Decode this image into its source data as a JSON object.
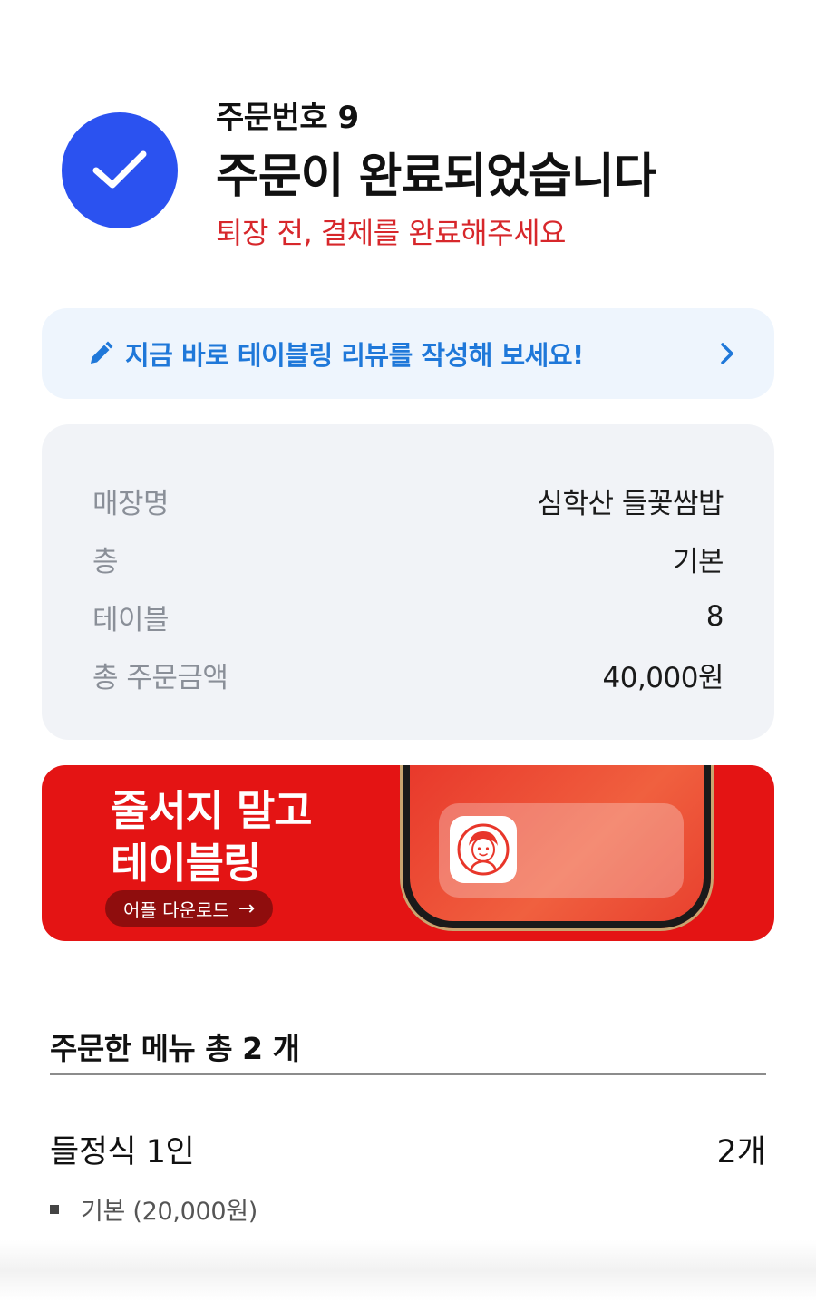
{
  "header": {
    "order_number": "주문번호 9",
    "title": "주문이 완료되었습니다",
    "notice": "퇴장 전, 결제를 완료해주세요"
  },
  "review_banner": {
    "text": "지금 바로 테이블링 리뷰를 작성해 보세요!",
    "icon": "pencil-icon",
    "arrow_icon": "chevron-right-icon"
  },
  "order_info": {
    "rows": [
      {
        "label": "매장명",
        "value": "심학산 들꽃쌈밥"
      },
      {
        "label": "층",
        "value": "기본"
      },
      {
        "label": "테이블",
        "value": "8"
      },
      {
        "label": "총 주문금액",
        "value": "40,000원"
      }
    ]
  },
  "promo": {
    "line1": "줄서지 말고",
    "line2": "테이블링",
    "button": "어플 다운로드",
    "button_arrow": "→"
  },
  "menu": {
    "title": "주문한 메뉴 총 2 개",
    "items": [
      {
        "name": "들정식 1인",
        "quantity": "2개",
        "option": "기본 (20,000원)"
      }
    ]
  },
  "colors": {
    "accent_blue": "#2b52f0",
    "notice_red": "#d7272b",
    "review_text": "#1f78d9",
    "promo_red": "#e41414"
  }
}
